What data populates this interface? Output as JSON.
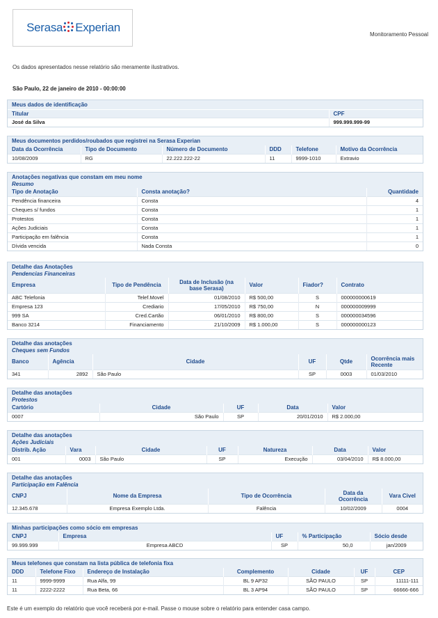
{
  "header": {
    "logo_left": "Serasa",
    "logo_right": "Experian",
    "product": "Monitoramento Pessoal"
  },
  "intro_note": "Os dados apresentados nesse relatório são meramente ilustrativos.",
  "date_line": "São Paulo, 22 de janeiro de 2010 - 00:00:00",
  "identificacao": {
    "title": "Meus dados de identificação",
    "col_titular": "Titular",
    "col_cpf": "CPF",
    "titular": "José da Silva",
    "cpf": "999.999.999-99"
  },
  "documentos": {
    "title": "Meus documentos perdidos/roubados que registrei na Serasa Experian",
    "headers": [
      "Data da Ocorrência",
      "Tipo de Documento",
      "Número de Documento",
      "DDD",
      "Telefone",
      "Motivo da Ocorrência"
    ],
    "rows": [
      [
        "10/08/2009",
        "RG",
        "22.222.222-22",
        "11",
        "9999-1010",
        "Extravio"
      ]
    ]
  },
  "anotacoes": {
    "title": "Anotações negativas que constam em meu nome",
    "subtitle": "Resumo",
    "headers": [
      "Tipo de Anotação",
      "Consta anotação?",
      "Quantidade"
    ],
    "rows": [
      [
        "Pendência financeira",
        "Consta",
        "4"
      ],
      [
        "Cheques s/ fundos",
        "Consta",
        "1"
      ],
      [
        "Protestos",
        "Consta",
        "1"
      ],
      [
        "Ações Judiciais",
        "Consta",
        "1"
      ],
      [
        "Participação em falência",
        "Consta",
        "1"
      ],
      [
        "Dívida vencida",
        "Nada Consta",
        "0"
      ]
    ]
  },
  "pendencias": {
    "title": "Detalhe das Anotações",
    "subtitle": "Pendencias Financeiras",
    "headers": [
      "Empresa",
      "Tipo de Pendência",
      "Data de Inclusão (na base Serasa)",
      "Valor",
      "Fiador?",
      "Contrato"
    ],
    "rows": [
      [
        "ABC Telefonia",
        "Telef.Movel",
        "01/08/2010",
        "R$ 500,00",
        "S",
        "000000000619"
      ],
      [
        "Empresa 123",
        "Crediario",
        "17/05/2010",
        "R$ 750,00",
        "N",
        "000000009999"
      ],
      [
        "999 SA",
        "Cred.Cartão",
        "06/01/2010",
        "R$ 800,00",
        "S",
        "000000034596"
      ],
      [
        "Banco 3214",
        "Financiamento",
        "21/10/2009",
        "R$ 1.000,00",
        "S",
        "000000000123"
      ]
    ]
  },
  "cheques": {
    "title": "Detalhe das anotações",
    "subtitle": "Cheques sem Fundos",
    "headers": [
      "Banco",
      "Agência",
      "Cidade",
      "UF",
      "Qtde",
      "Ocorrência mais Recente"
    ],
    "rows": [
      [
        "341",
        "2892",
        "São Paulo",
        "SP",
        "0003",
        "01/03/2010"
      ]
    ]
  },
  "protestos": {
    "title": "Detalhe das anotações",
    "subtitle": "Protestos",
    "headers": [
      "Cartório",
      "Cidade",
      "UF",
      "Data",
      "Valor"
    ],
    "rows": [
      [
        "0007",
        "São Paulo",
        "SP",
        "20/01/2010",
        "R$ 2.000,00"
      ]
    ]
  },
  "acoes": {
    "title": "Detalhe das anotações",
    "subtitle": "Ações Judiciais",
    "headers": [
      "Distrib. Ação",
      "Vara",
      "Cidade",
      "UF",
      "Natureza",
      "Data",
      "Valor"
    ],
    "rows": [
      [
        "001",
        "0003",
        "São Paulo",
        "SP",
        "Execução",
        "03/04/2010",
        "R$ 8.000,00"
      ]
    ]
  },
  "falencia": {
    "title": "Detalhe das anotações",
    "subtitle": "Participação em Falência",
    "headers": [
      "CNPJ",
      "Nome da Empresa",
      "Tipo de Ocorrência",
      "Data da Ocorrência",
      "Vara Civel"
    ],
    "rows": [
      [
        "12.345.678",
        "Empresa Exemplo Ltda.",
        "Falência",
        "10/02/2009",
        "0004"
      ]
    ]
  },
  "socio": {
    "title": "Minhas participações como sócio em empresas",
    "headers": [
      "CNPJ",
      "Empresa",
      "UF",
      "% Participação",
      "Sócio desde"
    ],
    "rows": [
      [
        "99.999.999",
        "Empresa ABCD",
        "SP",
        "50,0",
        "jan/2009"
      ]
    ]
  },
  "telefones": {
    "title": "Meus telefones que constam na lista pública de telefonia fixa",
    "headers": [
      "DDD",
      "Telefone Fixo",
      "Endereço de Instalação",
      "Complemento",
      "Cidade",
      "UF",
      "CEP"
    ],
    "rows": [
      [
        "11",
        "9999-9999",
        "Rua Alfa, 99",
        "BL 9 AP32",
        "SÃO PAULO",
        "SP",
        "11111-111"
      ],
      [
        "11",
        "2222-2222",
        "Rua Beta, 66",
        "BL 3 AP94",
        "SÃO PAULO",
        "SP",
        "66666-666"
      ]
    ]
  },
  "footer_note": "Este é um exemplo do relatório que você receberá por e-mail. Passe o mouse sobre o relatório para entender casa campo.",
  "colors": {
    "section_header": "#e8eff6",
    "title_text": "#1e4a8c",
    "border": "#c9d7e3",
    "logo_blue": "#1b5faa",
    "logo_red": "#d7262f"
  }
}
